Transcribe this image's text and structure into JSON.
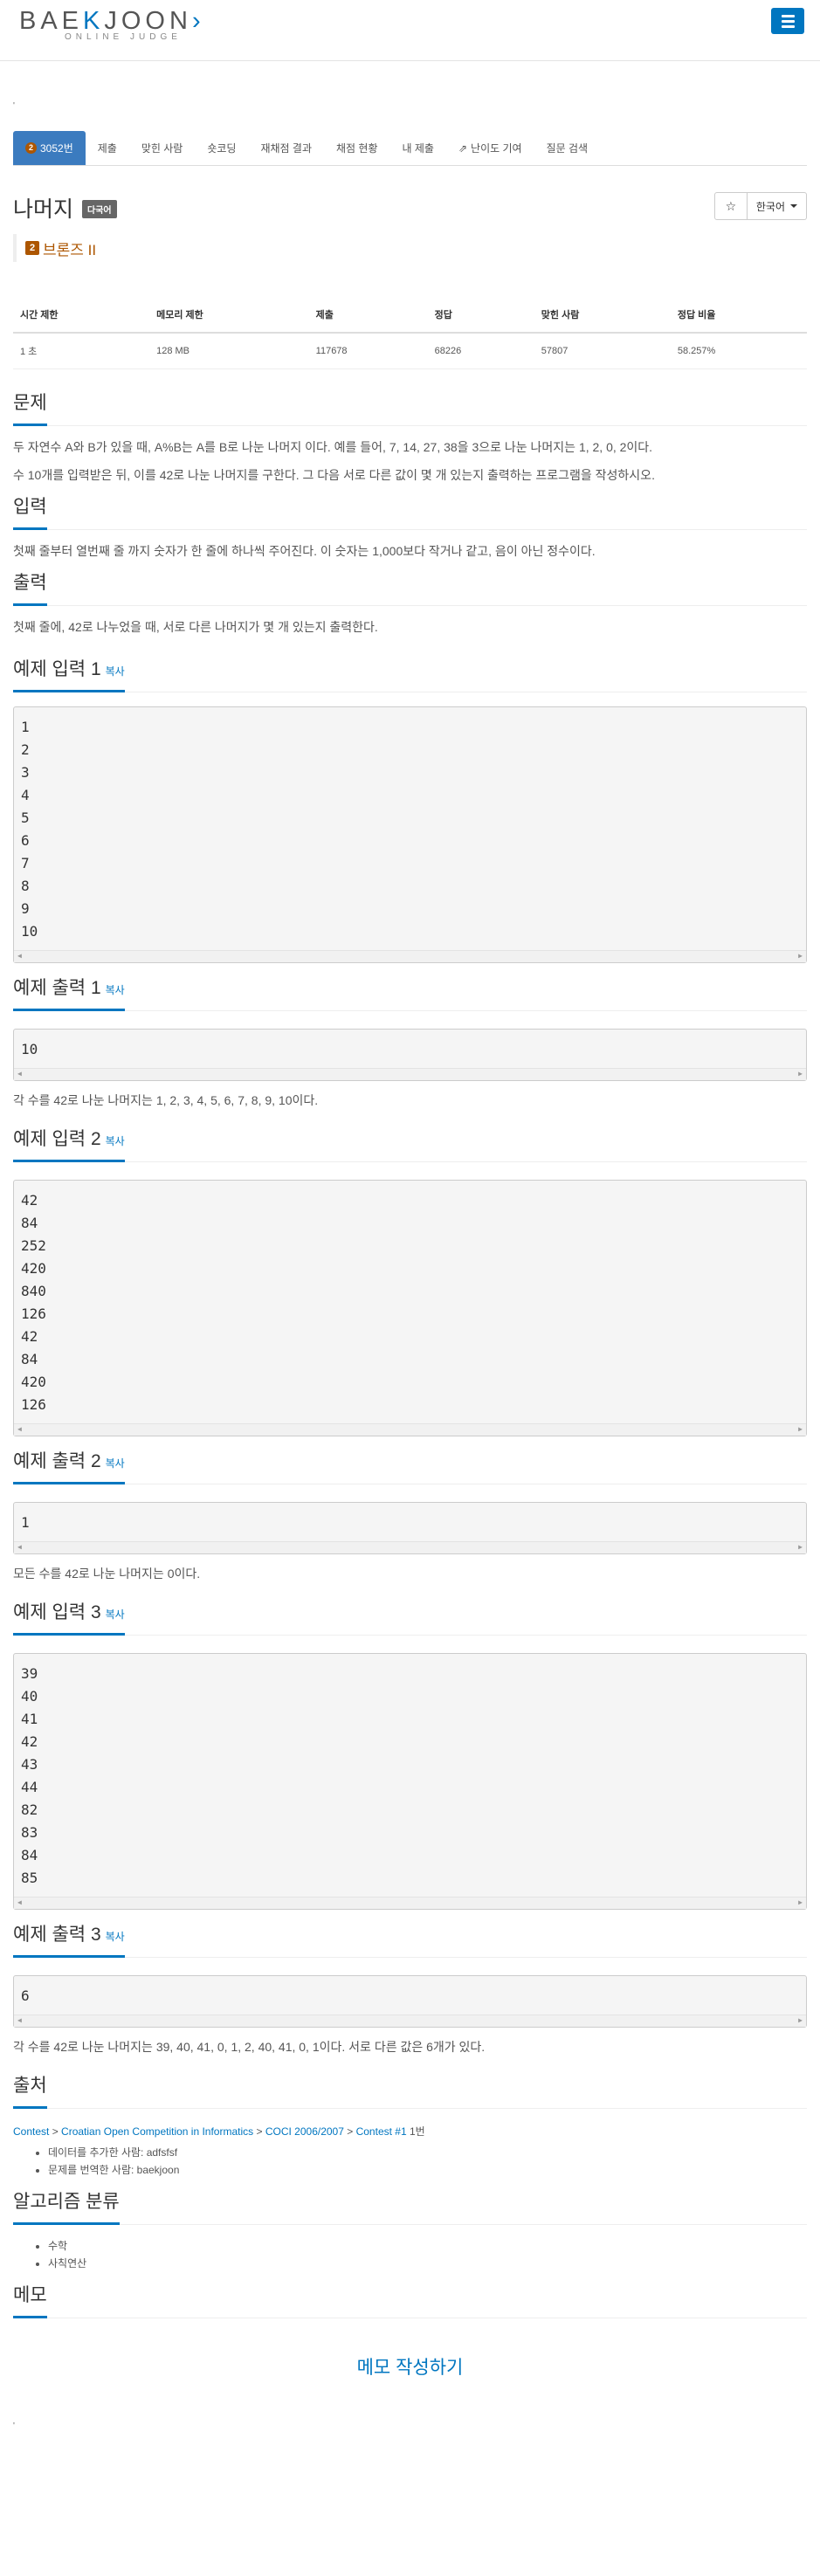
{
  "logo": {
    "main_a": "BAE",
    "main_k": "K",
    "main_b": "JOON",
    "mark": "›",
    "sub": "ONLINE JUDGE"
  },
  "top_dot": "'",
  "tabs": [
    {
      "label": "3052번",
      "active": true
    },
    {
      "label": "제출"
    },
    {
      "label": "맞힌 사람"
    },
    {
      "label": "숏코딩"
    },
    {
      "label": "재채점 결과"
    },
    {
      "label": "채점 현황"
    },
    {
      "label": "내 제출"
    },
    {
      "label": "난이도 기여"
    },
    {
      "label": "질문 검색"
    }
  ],
  "tier_digit": "2",
  "problem": {
    "title": "나머지",
    "lang_badge": "다국어",
    "star": "☆",
    "lang_select": "한국어",
    "tier": "브론즈 II"
  },
  "info_table": {
    "headers": [
      "시간 제한",
      "메모리 제한",
      "제출",
      "정답",
      "맞힌 사람",
      "정답 비율"
    ],
    "row": [
      "1 초",
      "128 MB",
      "117678",
      "68226",
      "57807",
      "58.257%"
    ]
  },
  "copy_label": "복사",
  "sections": {
    "desc_title": "문제",
    "desc_p1": "두 자연수 A와 B가 있을 때, A%B는 A를 B로 나눈 나머지 이다. 예를 들어, 7, 14, 27, 38을 3으로 나눈 나머지는 1, 2, 0, 2이다.",
    "desc_p2": "수 10개를 입력받은 뒤, 이를 42로 나눈 나머지를 구한다. 그 다음 서로 다른 값이 몇 개 있는지 출력하는 프로그램을 작성하시오.",
    "input_title": "입력",
    "input_text": "첫째 줄부터 열번째 줄 까지 숫자가 한 줄에 하나씩 주어진다. 이 숫자는 1,000보다 작거나 같고, 음이 아닌 정수이다.",
    "output_title": "출력",
    "output_text": "첫째 줄에, 42로 나누었을 때, 서로 다른 나머지가 몇 개 있는지 출력한다."
  },
  "examples": [
    {
      "in_title": "예제 입력 1",
      "input": [
        "1",
        "2",
        "3",
        "4",
        "5",
        "6",
        "7",
        "8",
        "9",
        "10"
      ],
      "out_title": "예제 출력 1",
      "output": [
        "10"
      ],
      "note": "각 수를 42로 나눈 나머지는 1, 2, 3, 4, 5, 6, 7, 8, 9, 10이다."
    },
    {
      "in_title": "예제 입력 2",
      "input": [
        "42",
        "84",
        "252",
        "420",
        "840",
        "126",
        "42",
        "84",
        "420",
        "126"
      ],
      "out_title": "예제 출력 2",
      "output": [
        "1"
      ],
      "note": "모든 수를 42로 나눈 나머지는 0이다."
    },
    {
      "in_title": "예제 입력 3",
      "input": [
        "39",
        "40",
        "41",
        "42",
        "43",
        "44",
        "82",
        "83",
        "84",
        "85"
      ],
      "out_title": "예제 출력 3",
      "output": [
        "6"
      ],
      "note": "각 수를 42로 나눈 나머지는 39, 40, 41, 0, 1, 2, 40, 41, 0, 1이다. 서로 다른 값은 6개가 있다."
    }
  ],
  "source": {
    "title": "출처",
    "links": [
      "Contest",
      "Croatian Open Competition in Informatics",
      "COCI 2006/2007",
      "Contest #1"
    ],
    "sep": " > ",
    "suffix": " 1번",
    "bullets": [
      "데이터를 추가한 사람: adfsfsf",
      "문제를 번역한 사람: baekjoon"
    ]
  },
  "algo": {
    "title": "알고리즘 분류",
    "items": [
      "수학",
      "사칙연산"
    ]
  },
  "memo": {
    "title": "메모",
    "button": "메모 작성하기"
  },
  "bottom_dot": "'"
}
